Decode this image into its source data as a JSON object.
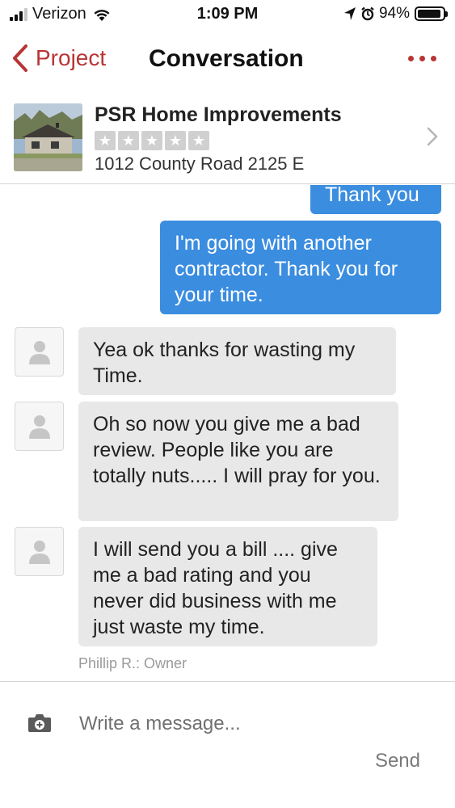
{
  "status_bar": {
    "carrier": "Verizon",
    "time": "1:09 PM",
    "battery_percent": "94%",
    "battery_level": 0.94
  },
  "nav": {
    "back_label": "Project",
    "title": "Conversation"
  },
  "business": {
    "name": "PSR Home Improvements",
    "rating_stars_filled": 0,
    "rating_stars_total": 5,
    "address": "1012 County Road 2125 E"
  },
  "messages": {
    "outgoing": [
      {
        "text": "Thank you"
      },
      {
        "text": "I'm going with another contractor. Thank you for your time."
      }
    ],
    "incoming": [
      {
        "text": "Yea ok thanks for wasting my Time."
      },
      {
        "text": "Oh so now you give me a bad review.  People like you are totally nuts..... I will pray for you."
      },
      {
        "text": "I will send you a bill .... give me a bad rating and you never did business with me just waste my time."
      }
    ],
    "sender_label": "Phillip R.: Owner"
  },
  "compose": {
    "placeholder": "Write a message...",
    "send_label": "Send"
  },
  "colors": {
    "accent": "#b83535",
    "outgoing_bubble": "#3b8de0",
    "incoming_bubble": "#e8e8e8"
  },
  "icons": [
    "signal-icon",
    "wifi-icon",
    "location-arrow-icon",
    "alarm-icon",
    "battery-icon",
    "chevron-left-icon",
    "more-dots-icon",
    "star-icon",
    "chevron-right-icon",
    "user-avatar-icon",
    "camera-icon"
  ]
}
